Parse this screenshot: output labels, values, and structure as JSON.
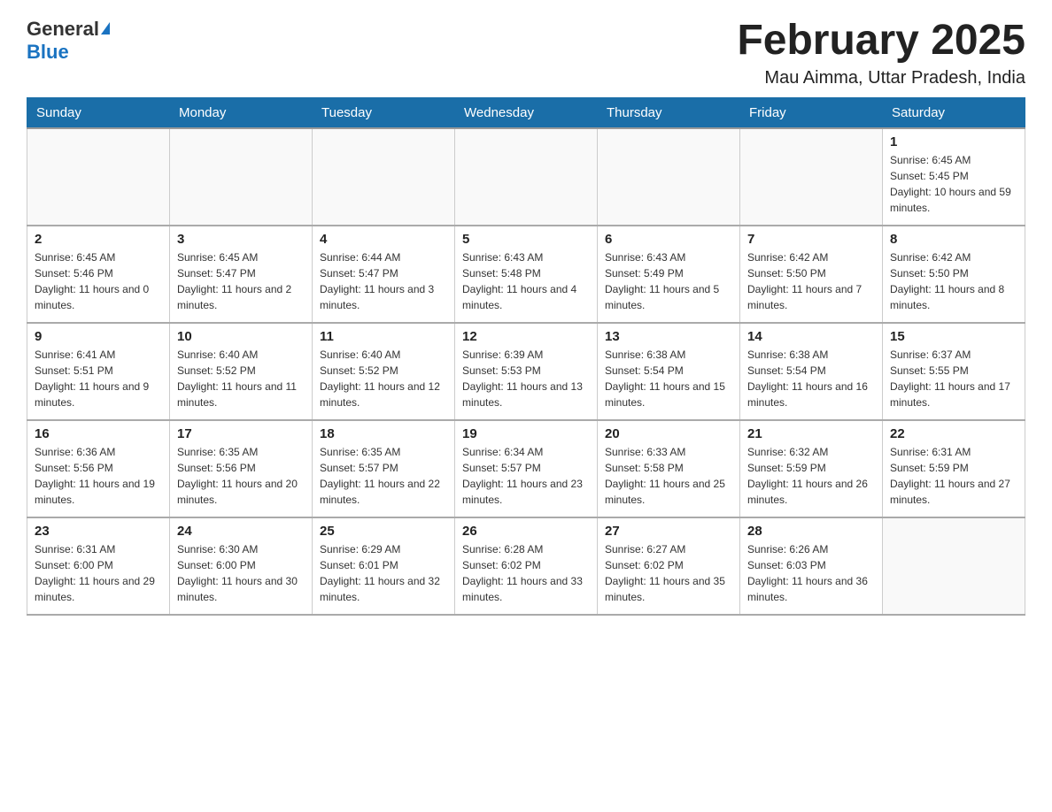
{
  "header": {
    "logo": {
      "general": "General",
      "blue": "Blue"
    },
    "title": "February 2025",
    "location": "Mau Aimma, Uttar Pradesh, India"
  },
  "days_of_week": [
    "Sunday",
    "Monday",
    "Tuesday",
    "Wednesday",
    "Thursday",
    "Friday",
    "Saturday"
  ],
  "weeks": [
    [
      {
        "day": "",
        "sunrise": "",
        "sunset": "",
        "daylight": ""
      },
      {
        "day": "",
        "sunrise": "",
        "sunset": "",
        "daylight": ""
      },
      {
        "day": "",
        "sunrise": "",
        "sunset": "",
        "daylight": ""
      },
      {
        "day": "",
        "sunrise": "",
        "sunset": "",
        "daylight": ""
      },
      {
        "day": "",
        "sunrise": "",
        "sunset": "",
        "daylight": ""
      },
      {
        "day": "",
        "sunrise": "",
        "sunset": "",
        "daylight": ""
      },
      {
        "day": "1",
        "sunrise": "Sunrise: 6:45 AM",
        "sunset": "Sunset: 5:45 PM",
        "daylight": "Daylight: 10 hours and 59 minutes."
      }
    ],
    [
      {
        "day": "2",
        "sunrise": "Sunrise: 6:45 AM",
        "sunset": "Sunset: 5:46 PM",
        "daylight": "Daylight: 11 hours and 0 minutes."
      },
      {
        "day": "3",
        "sunrise": "Sunrise: 6:45 AM",
        "sunset": "Sunset: 5:47 PM",
        "daylight": "Daylight: 11 hours and 2 minutes."
      },
      {
        "day": "4",
        "sunrise": "Sunrise: 6:44 AM",
        "sunset": "Sunset: 5:47 PM",
        "daylight": "Daylight: 11 hours and 3 minutes."
      },
      {
        "day": "5",
        "sunrise": "Sunrise: 6:43 AM",
        "sunset": "Sunset: 5:48 PM",
        "daylight": "Daylight: 11 hours and 4 minutes."
      },
      {
        "day": "6",
        "sunrise": "Sunrise: 6:43 AM",
        "sunset": "Sunset: 5:49 PM",
        "daylight": "Daylight: 11 hours and 5 minutes."
      },
      {
        "day": "7",
        "sunrise": "Sunrise: 6:42 AM",
        "sunset": "Sunset: 5:50 PM",
        "daylight": "Daylight: 11 hours and 7 minutes."
      },
      {
        "day": "8",
        "sunrise": "Sunrise: 6:42 AM",
        "sunset": "Sunset: 5:50 PM",
        "daylight": "Daylight: 11 hours and 8 minutes."
      }
    ],
    [
      {
        "day": "9",
        "sunrise": "Sunrise: 6:41 AM",
        "sunset": "Sunset: 5:51 PM",
        "daylight": "Daylight: 11 hours and 9 minutes."
      },
      {
        "day": "10",
        "sunrise": "Sunrise: 6:40 AM",
        "sunset": "Sunset: 5:52 PM",
        "daylight": "Daylight: 11 hours and 11 minutes."
      },
      {
        "day": "11",
        "sunrise": "Sunrise: 6:40 AM",
        "sunset": "Sunset: 5:52 PM",
        "daylight": "Daylight: 11 hours and 12 minutes."
      },
      {
        "day": "12",
        "sunrise": "Sunrise: 6:39 AM",
        "sunset": "Sunset: 5:53 PM",
        "daylight": "Daylight: 11 hours and 13 minutes."
      },
      {
        "day": "13",
        "sunrise": "Sunrise: 6:38 AM",
        "sunset": "Sunset: 5:54 PM",
        "daylight": "Daylight: 11 hours and 15 minutes."
      },
      {
        "day": "14",
        "sunrise": "Sunrise: 6:38 AM",
        "sunset": "Sunset: 5:54 PM",
        "daylight": "Daylight: 11 hours and 16 minutes."
      },
      {
        "day": "15",
        "sunrise": "Sunrise: 6:37 AM",
        "sunset": "Sunset: 5:55 PM",
        "daylight": "Daylight: 11 hours and 17 minutes."
      }
    ],
    [
      {
        "day": "16",
        "sunrise": "Sunrise: 6:36 AM",
        "sunset": "Sunset: 5:56 PM",
        "daylight": "Daylight: 11 hours and 19 minutes."
      },
      {
        "day": "17",
        "sunrise": "Sunrise: 6:35 AM",
        "sunset": "Sunset: 5:56 PM",
        "daylight": "Daylight: 11 hours and 20 minutes."
      },
      {
        "day": "18",
        "sunrise": "Sunrise: 6:35 AM",
        "sunset": "Sunset: 5:57 PM",
        "daylight": "Daylight: 11 hours and 22 minutes."
      },
      {
        "day": "19",
        "sunrise": "Sunrise: 6:34 AM",
        "sunset": "Sunset: 5:57 PM",
        "daylight": "Daylight: 11 hours and 23 minutes."
      },
      {
        "day": "20",
        "sunrise": "Sunrise: 6:33 AM",
        "sunset": "Sunset: 5:58 PM",
        "daylight": "Daylight: 11 hours and 25 minutes."
      },
      {
        "day": "21",
        "sunrise": "Sunrise: 6:32 AM",
        "sunset": "Sunset: 5:59 PM",
        "daylight": "Daylight: 11 hours and 26 minutes."
      },
      {
        "day": "22",
        "sunrise": "Sunrise: 6:31 AM",
        "sunset": "Sunset: 5:59 PM",
        "daylight": "Daylight: 11 hours and 27 minutes."
      }
    ],
    [
      {
        "day": "23",
        "sunrise": "Sunrise: 6:31 AM",
        "sunset": "Sunset: 6:00 PM",
        "daylight": "Daylight: 11 hours and 29 minutes."
      },
      {
        "day": "24",
        "sunrise": "Sunrise: 6:30 AM",
        "sunset": "Sunset: 6:00 PM",
        "daylight": "Daylight: 11 hours and 30 minutes."
      },
      {
        "day": "25",
        "sunrise": "Sunrise: 6:29 AM",
        "sunset": "Sunset: 6:01 PM",
        "daylight": "Daylight: 11 hours and 32 minutes."
      },
      {
        "day": "26",
        "sunrise": "Sunrise: 6:28 AM",
        "sunset": "Sunset: 6:02 PM",
        "daylight": "Daylight: 11 hours and 33 minutes."
      },
      {
        "day": "27",
        "sunrise": "Sunrise: 6:27 AM",
        "sunset": "Sunset: 6:02 PM",
        "daylight": "Daylight: 11 hours and 35 minutes."
      },
      {
        "day": "28",
        "sunrise": "Sunrise: 6:26 AM",
        "sunset": "Sunset: 6:03 PM",
        "daylight": "Daylight: 11 hours and 36 minutes."
      },
      {
        "day": "",
        "sunrise": "",
        "sunset": "",
        "daylight": ""
      }
    ]
  ]
}
